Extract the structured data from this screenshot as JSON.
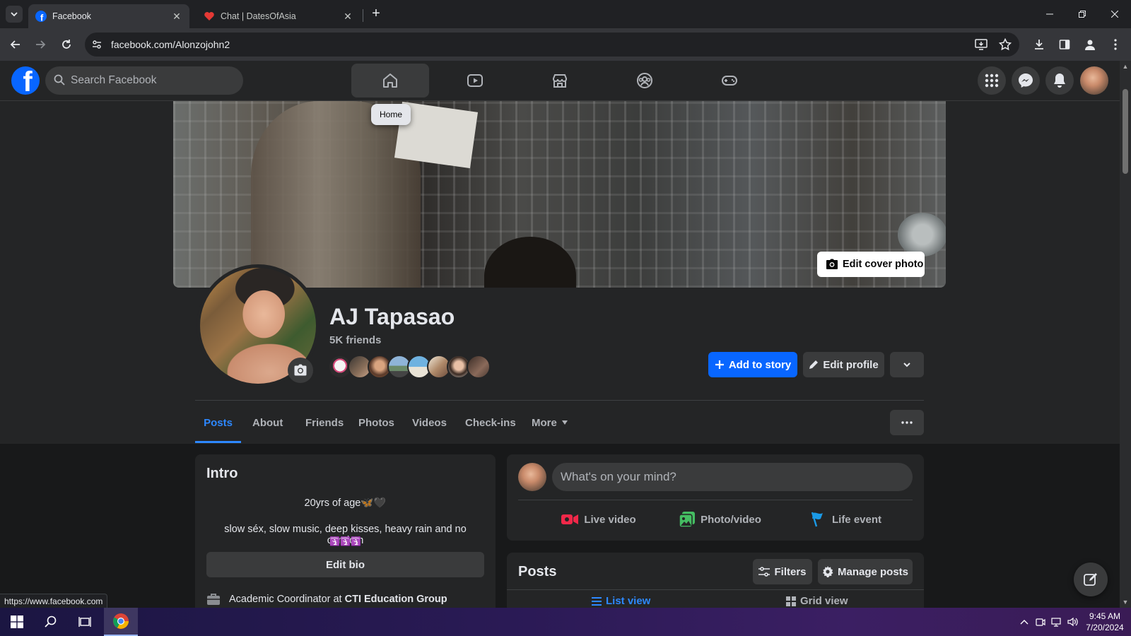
{
  "browser": {
    "tabs": [
      {
        "title": "Facebook",
        "active": true
      },
      {
        "title": "Chat | DatesOfAsia",
        "active": false
      }
    ],
    "url": "facebook.com/Alonzojohn2",
    "status_url": "https://www.facebook.com"
  },
  "fb_nav": {
    "logo": "f",
    "search_placeholder": "Search Facebook",
    "tabs": [
      "home-icon",
      "video-icon",
      "marketplace-icon",
      "groups-icon",
      "gaming-icon"
    ],
    "tooltip": "Home",
    "brand_color": "#0866ff"
  },
  "profile": {
    "name": "AJ Tapasao",
    "friends": "5K friends",
    "edit_cover": "Edit cover photo",
    "add_to_story": "Add to story",
    "edit_profile": "Edit profile",
    "tabs": [
      "Posts",
      "About",
      "Friends",
      "Photos",
      "Videos",
      "Check-ins",
      "More"
    ],
    "active_tab": "Posts"
  },
  "intro": {
    "title": "Intro",
    "bio_line1": "20yrs of age🦋🖤",
    "bio_line2": "slow séx, slow music, deep kisses, heavy rain and no condom",
    "bio_line3": "🛐🛐🛐",
    "edit_bio": "Edit bio",
    "work_prefix": "Academic Coordinator at ",
    "work_company": "CTI Education Group"
  },
  "composer": {
    "placeholder": "What's on your mind?",
    "live_video": "Live video",
    "photo_video": "Photo/video",
    "life_event": "Life event"
  },
  "posts": {
    "title": "Posts",
    "filters": "Filters",
    "manage": "Manage posts",
    "list_view": "List view",
    "grid_view": "Grid view"
  },
  "taskbar": {
    "time": "9:45 AM",
    "date": "7/20/2024"
  }
}
